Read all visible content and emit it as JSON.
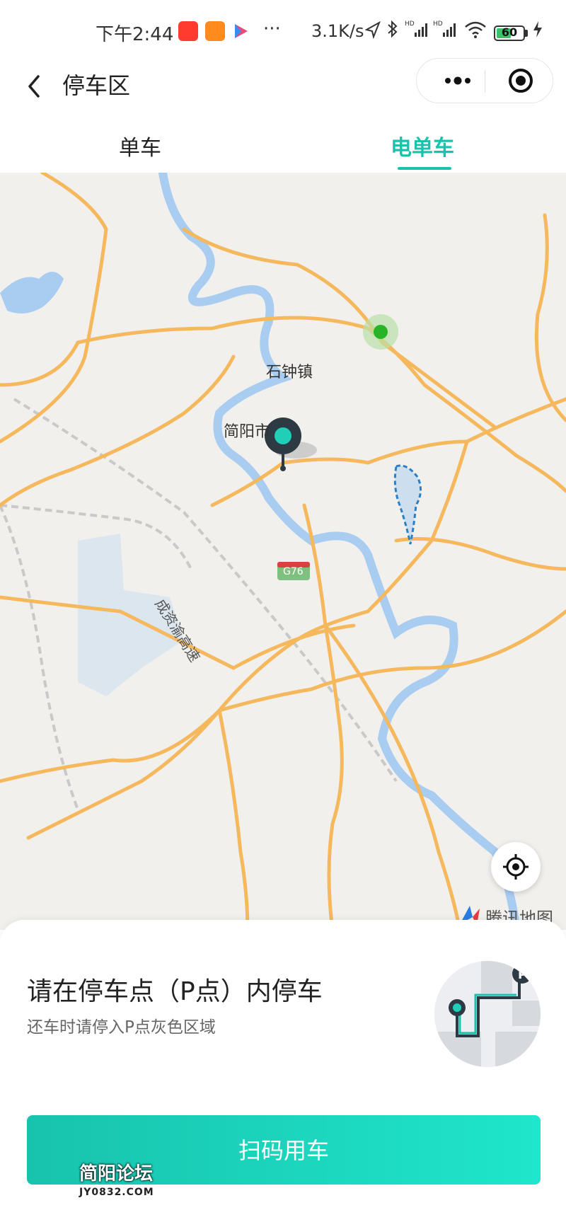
{
  "status_bar": {
    "time": "下午2:44",
    "more": "···",
    "net_speed": "3.1K/s",
    "battery": "60",
    "battery_fraction": 0.6,
    "icons": [
      "tmall-app-icon",
      "renrenche-app-icon",
      "play-store-icon",
      "location-arrow-icon",
      "bluetooth-icon",
      "signal-hd-icon",
      "signal-hd-icon",
      "wifi-icon",
      "battery-icon",
      "charging-icon"
    ]
  },
  "header": {
    "title": "停车区",
    "back_icon": "chevron-left-icon",
    "menu_icon": "more-dots-icon",
    "close_icon": "target-circle-icon"
  },
  "tabs": [
    {
      "label": "单车",
      "active": false
    },
    {
      "label": "电单车",
      "active": true
    }
  ],
  "map": {
    "labels": {
      "town": "石钟镇",
      "city": "简阳市",
      "highway": "G76",
      "expressway": "成资渝高速"
    },
    "provider": "腾讯地图",
    "locate_icon": "crosshair-icon",
    "marker_icon": "location-pin-icon"
  },
  "sheet": {
    "title": "请在停车点（P点）内停车",
    "subtitle": "还车时请停入P点灰色区域",
    "illustration_icon": "parking-route-icon",
    "scan_button": "扫码用车"
  },
  "watermark": {
    "line1": "简阳论坛",
    "line2": "JY0832.COM"
  },
  "colors": {
    "accent": "#18c3ae",
    "road": "#f5b85c",
    "water": "#a9cdf1"
  }
}
